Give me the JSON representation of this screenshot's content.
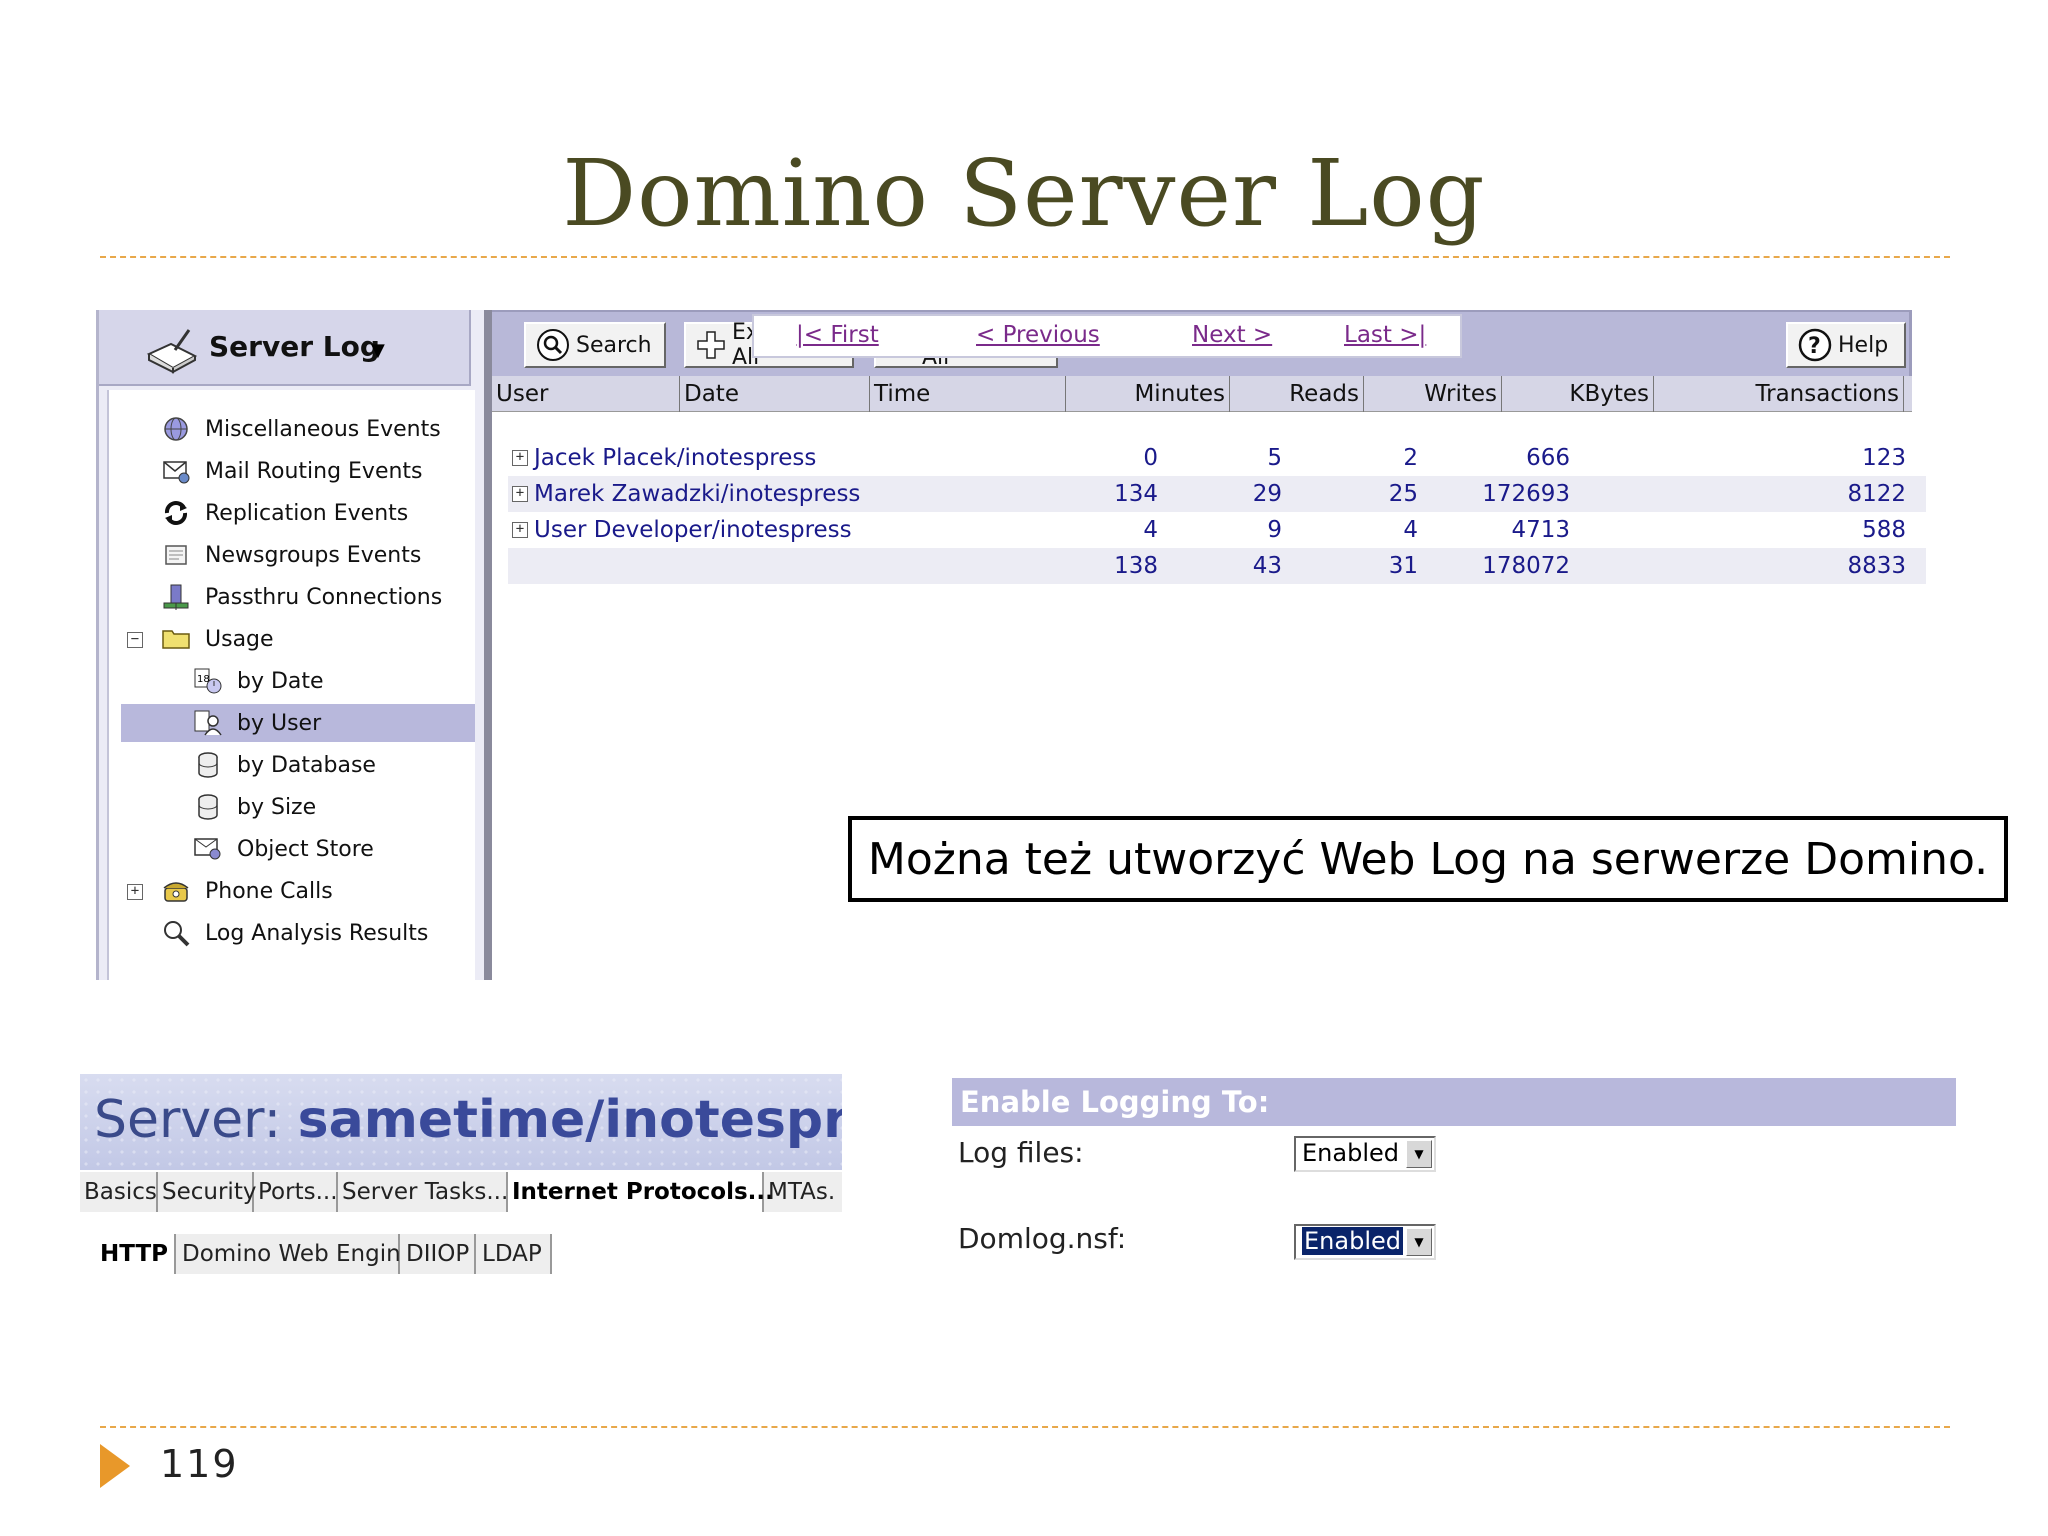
{
  "slide": {
    "title": "Domino Server Log",
    "page_number": "119",
    "note": "Można też utworzyć Web Log na serwerze Domino."
  },
  "left_panel": {
    "title": "Server Log",
    "items": [
      {
        "label": "Miscellaneous Events",
        "icon": "globe-icon"
      },
      {
        "label": "Mail Routing Events",
        "icon": "mail-routing-icon"
      },
      {
        "label": "Replication Events",
        "icon": "replication-icon"
      },
      {
        "label": "Newsgroups Events",
        "icon": "newsgroups-icon"
      },
      {
        "label": "Passthru Connections",
        "icon": "passthru-icon"
      },
      {
        "label": "Usage",
        "icon": "folder-icon",
        "expander": "⊟"
      },
      {
        "label": "by Date",
        "icon": "calendar-icon"
      },
      {
        "label": "by User",
        "icon": "user-icon",
        "selected": true
      },
      {
        "label": "by Database",
        "icon": "database-icon"
      },
      {
        "label": "by Size",
        "icon": "database-icon"
      },
      {
        "label": "Object Store",
        "icon": "object-store-icon"
      },
      {
        "label": "Phone Calls",
        "icon": "phone-icon",
        "expander": "⊞"
      },
      {
        "label": "Log Analysis Results",
        "icon": "magnifier-icon"
      }
    ]
  },
  "toolbar": {
    "search_label": "Search",
    "expand_label": "Expand All",
    "collapse_label": "Collapse All",
    "help_label": "Help"
  },
  "table": {
    "columns": [
      "User",
      "Date",
      "Time",
      "Minutes",
      "Reads",
      "Writes",
      "KBytes",
      "Transactions"
    ],
    "rows": [
      {
        "user": "Jacek Placek/inotespress",
        "minutes": "0",
        "reads": "5",
        "writes": "2",
        "kbytes": "666",
        "transactions": "123"
      },
      {
        "user": "Marek Zawadzki/inotespress",
        "minutes": "134",
        "reads": "29",
        "writes": "25",
        "kbytes": "172693",
        "transactions": "8122"
      },
      {
        "user": "User Developer/inotespress",
        "minutes": "4",
        "reads": "9",
        "writes": "4",
        "kbytes": "4713",
        "transactions": "588"
      }
    ],
    "totals": {
      "minutes": "138",
      "reads": "43",
      "writes": "31",
      "kbytes": "178072",
      "transactions": "8833"
    }
  },
  "pager": {
    "first": "|< First",
    "previous": "< Previous",
    "next": "Next >",
    "last": "Last >|"
  },
  "server": {
    "prefix": "Server: ",
    "name": "sametime/inotespress",
    "tabs": [
      "Basics",
      "Security",
      "Ports...",
      "Server Tasks...",
      "Internet Protocols...",
      "MTAs."
    ],
    "active_tab": "Internet Protocols...",
    "subtabs": [
      "HTTP",
      "Domino Web Engine",
      "DIIOP",
      "LDAP"
    ],
    "active_subtab": "HTTP"
  },
  "logging": {
    "header": "Enable Logging To:",
    "log_files_label": "Log files:",
    "log_files_value": "Enabled",
    "domlog_label": "Domlog.nsf:",
    "domlog_value": "Enabled"
  },
  "colors": {
    "title": "#4a4a22",
    "accent_orange": "#e8982a",
    "toolbar": "#b8b8d8",
    "link": "#1a1a8a"
  }
}
